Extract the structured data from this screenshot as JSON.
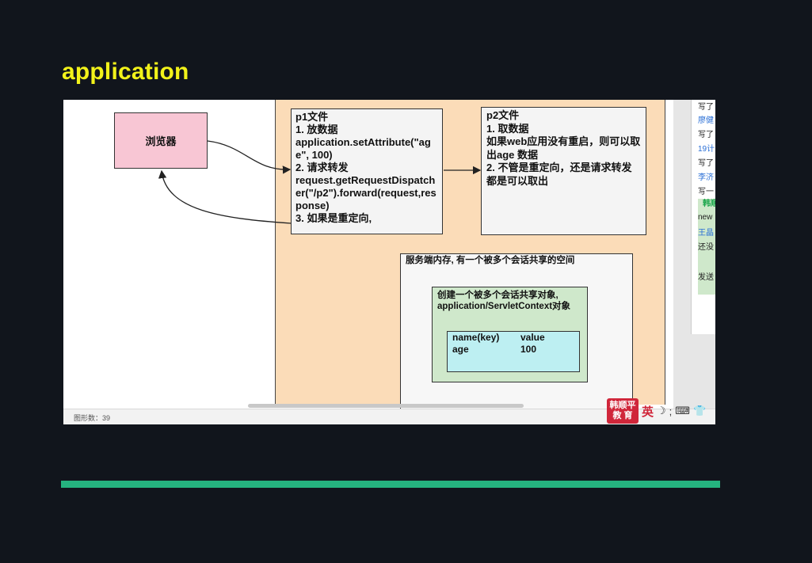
{
  "slide": {
    "title": "application",
    "accent_color": "#25b37f",
    "title_color": "#f2f21a"
  },
  "diagram": {
    "browser_label": "浏览器",
    "p1": {
      "title": "p1文件",
      "line1": "1. 放数据",
      "line2": "application.setAttribute(\"age\", 100)",
      "line3": "2. 请求转发",
      "line4": "request.getRequestDispatcher(\"/p2\").forward(request,response)",
      "line5": "3. 如果是重定向,"
    },
    "p2": {
      "title": "p2文件",
      "line1": "1. 取数据",
      "line2": "如果web应用没有重启，则可以取出age 数据",
      "line3": "2. 不管是重定向，还是请求转发都是可以取出"
    },
    "memory": {
      "title": "服务端内存, 有一个被多个会话共享的空间",
      "context_label": "创建一个被多个会话共享对象, application/ServletContext对象",
      "table_header": [
        "name(key)",
        "value"
      ],
      "table_row": [
        "age",
        "100"
      ]
    }
  },
  "side_panel": {
    "lines": [
      "写了",
      "廖健",
      "写了",
      "19计",
      "写了",
      "李济",
      "写一",
      "韩顺",
      "new",
      "王晶",
      "还没",
      "发送"
    ]
  },
  "status": {
    "shape_count": "图形数：39"
  },
  "ime": {
    "logo_line1": "韩顺平",
    "logo_line2": "教 育",
    "lang": "英",
    "icons": [
      "moon-icon",
      "keyboard-icon",
      "shirt-icon"
    ]
  }
}
